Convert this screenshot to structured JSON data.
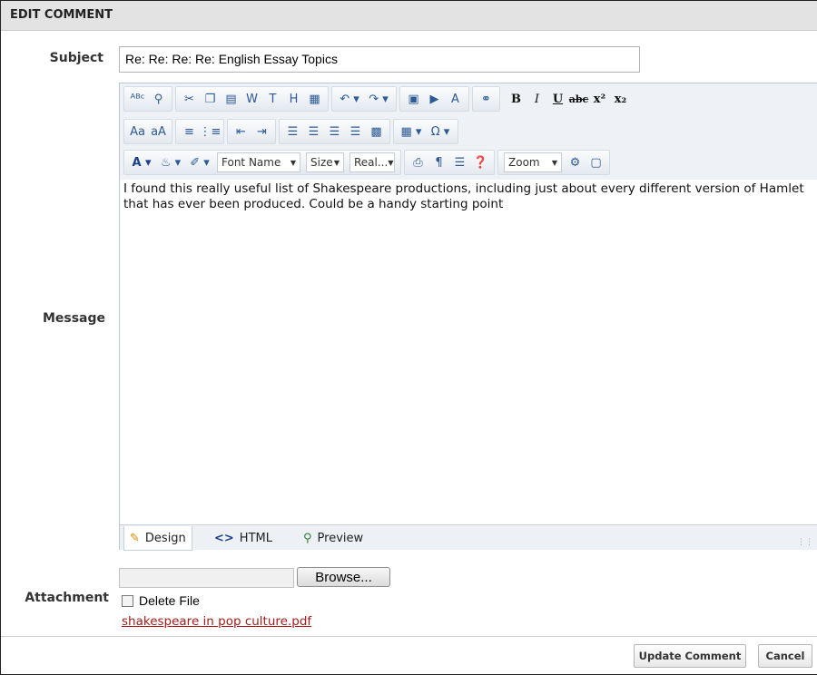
{
  "header": {
    "title": "EDIT COMMENT"
  },
  "form": {
    "subject_label": "Subject",
    "subject_value": "Re: Re: Re: Re: English Essay Topics",
    "message_label": "Message",
    "attachment_label": "Attachment"
  },
  "editor": {
    "toolbar": {
      "font_name": "Font Name",
      "size": "Size",
      "real_font_size": "Real...",
      "zoom": "Zoom"
    },
    "message_text": "I found this really useful list of Shakespeare productions, including just about every different version of Hamlet that has ever been produced. Could be a handy starting point",
    "modes": {
      "design": "Design",
      "html": "HTML",
      "preview": "Preview"
    }
  },
  "attachment": {
    "browse_label": "Browse...",
    "delete_label": "Delete File",
    "file_name": "shakespeare in pop culture.pdf"
  },
  "actions": {
    "update": "Update Comment",
    "cancel": "Cancel"
  },
  "colors": {
    "header_bg": "#e3e3e3",
    "link": "#a51b1b",
    "toolbar_bg": "#eef2f7"
  }
}
